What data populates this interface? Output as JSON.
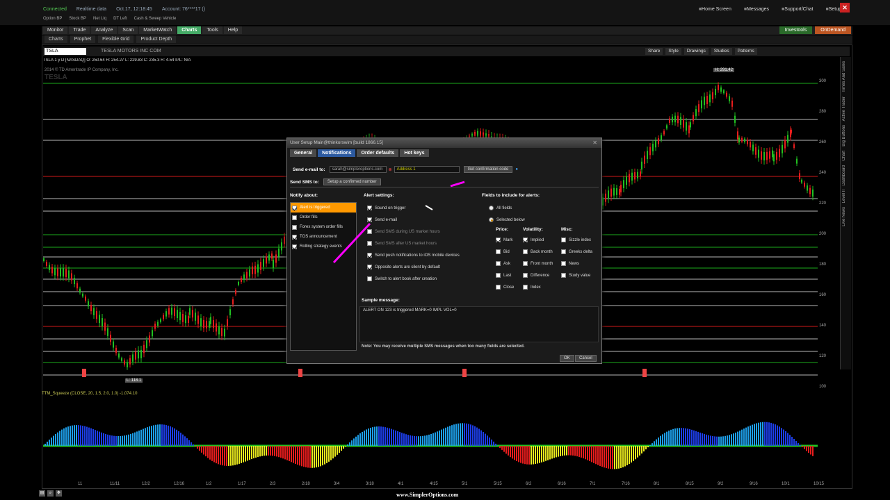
{
  "top": {
    "connected": "Connected",
    "realtime": "Realtime data",
    "datetime": "Oct.17, 12:18:45",
    "account": "Account: 76****17 ()",
    "links": [
      "Home Screen",
      "Messages",
      "Support/Chat",
      "Setup"
    ],
    "watch": [
      "Option BP",
      "Stock BP",
      "Net Liq",
      "DT Left",
      "Cash & Sweep Vehicle"
    ]
  },
  "nav": {
    "tabs": [
      "Monitor",
      "Trade",
      "Analyze",
      "Scan",
      "MarketWatch",
      "Charts",
      "Tools",
      "Help"
    ],
    "active": "Charts",
    "investools": "Investools",
    "ondemand": "OnDemand"
  },
  "subnav": [
    "Charts",
    "Prophet",
    "Flexible Grid",
    "Product Depth"
  ],
  "symbol": {
    "value": "TSLA",
    "company": "TESLA MOTORS INC COM",
    "tools": [
      "Share",
      "Style",
      "Drawings",
      "Studies",
      "Patterns"
    ],
    "quote": "TSLA 1 y D [NASDAQ]  O: 250.64  H: 254.27  L: 229.83  C: 235.3  R: 4.54  IPL: N/A",
    "copyright": "2014 © TD Ameritrade IP Company, Inc.",
    "watermark": "TESLA",
    "high_label": "H: 291.42",
    "low_label": "L: 118.1"
  },
  "price_axis": [
    "300",
    "280",
    "260",
    "240",
    "220",
    "200",
    "180",
    "160",
    "140",
    "120",
    "100"
  ],
  "study": {
    "header": "TTM_Squeeze (CLOSE, 20, 1.5, 2.0, 1.0)  -1,074.10"
  },
  "dates": [
    "11",
    "11/11",
    "12/2",
    "12/16",
    "1/2",
    "1/17",
    "2/3",
    "2/18",
    "3/4",
    "3/18",
    "4/1",
    "4/15",
    "5/1",
    "5/15",
    "6/2",
    "6/16",
    "7/1",
    "7/16",
    "8/1",
    "8/15",
    "9/2",
    "9/16",
    "10/1",
    "10/15"
  ],
  "right_rail": [
    "Times And Sales",
    "Active Trader",
    "Big Buttons",
    "Chart",
    "Dashboard",
    "Level II",
    "Live News"
  ],
  "footer_brand": "www.SimplerOptions.com",
  "colors": {
    "bull": "#21c021",
    "bear": "#e81d1d",
    "hist_pos": "#1d5ee8",
    "hist_neg": "#e81d1d",
    "accent": "#2c5aa0"
  },
  "dialog": {
    "title": "User Setup Main@thinkorswim [build 1866.15]",
    "tabs": [
      "General",
      "Notifications",
      "Order defaults",
      "Hot keys"
    ],
    "active_tab": "Notifications",
    "send_email_label": "Send e-mail to:",
    "email_value": "sarah@simpleroptions.com",
    "address_value": "Address 1",
    "confirm_code_btn": "Get confirmation code",
    "send_sms_label": "Send SMS to:",
    "sms_btn": "Setup a confirmed number",
    "notify_label": "Notify about:",
    "notify_items": [
      {
        "label": "Alert is triggered",
        "checked": true,
        "selected": true
      },
      {
        "label": "Order fills",
        "checked": false,
        "selected": false
      },
      {
        "label": "Forex system order fills",
        "checked": false,
        "selected": false
      },
      {
        "label": "TOS announcement",
        "checked": true,
        "selected": false
      },
      {
        "label": "Rolling strategy events",
        "checked": true,
        "selected": false
      }
    ],
    "alert_settings_label": "Alert settings:",
    "alert_settings": [
      {
        "label": "Sound on trigger",
        "checked": true
      },
      {
        "label": "Send e-mail",
        "checked": true
      },
      {
        "label": "Send SMS during US market hours",
        "checked": false
      },
      {
        "label": "Send SMS after US market hours",
        "checked": false
      },
      {
        "label": "Send push notifications to iOS mobile devices",
        "checked": true
      },
      {
        "label": "Opposite alerts are silent by default",
        "checked": true
      },
      {
        "label": "Switch to alert book after creation",
        "checked": false
      }
    ],
    "fields_label": "Fields to include for alerts:",
    "all_fields": "All fields",
    "selected_below": "Selected below",
    "price_label": "Price:",
    "price_items": [
      {
        "label": "Mark",
        "checked": true
      },
      {
        "label": "Bid",
        "checked": false
      },
      {
        "label": "Ask",
        "checked": false
      },
      {
        "label": "Last",
        "checked": false
      },
      {
        "label": "Close",
        "checked": false
      }
    ],
    "volatility_label": "Volatility:",
    "volatility_items": [
      {
        "label": "Implied",
        "checked": true
      },
      {
        "label": "Back month",
        "checked": false
      },
      {
        "label": "Front month",
        "checked": false
      },
      {
        "label": "Difference",
        "checked": false
      },
      {
        "label": "Index",
        "checked": false
      }
    ],
    "misc_label": "Misc:",
    "misc_items": [
      {
        "label": "Sizzle index",
        "checked": false
      },
      {
        "label": "Greeks delta",
        "checked": false
      },
      {
        "label": "News",
        "checked": false
      },
      {
        "label": "Study value",
        "checked": false
      }
    ],
    "sample_label": "Sample message:",
    "sample_text": "ALERT ON 123 is triggered MARK=0 IMPL VOL=0",
    "note": "Note: You may receive multiple SMS messages when too many fields are selected.",
    "ok": "OK",
    "cancel": "Cancel"
  }
}
